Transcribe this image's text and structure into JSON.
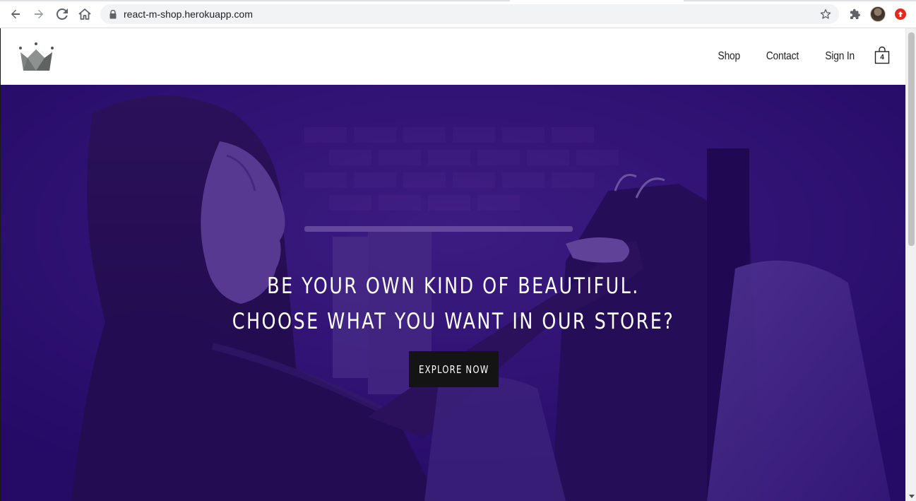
{
  "browser": {
    "url": "react-m-shop.herokuapp.com",
    "icons": {
      "back": "arrow-left-icon",
      "forward": "arrow-right-icon",
      "reload": "reload-icon",
      "home": "home-icon",
      "lock": "lock-icon",
      "bookmark": "star-icon",
      "extensions": "puzzle-icon",
      "profile": "avatar",
      "update": "update-arrow-icon"
    }
  },
  "site": {
    "logo_icon": "crown-icon",
    "nav": [
      {
        "label": "Shop"
      },
      {
        "label": "Contact"
      },
      {
        "label": "Sign In"
      }
    ],
    "cart": {
      "count": "4",
      "icon": "shopping-bag-icon"
    },
    "hero": {
      "line1": "BE YOUR OWN KIND OF BEAUTIFUL.",
      "line2": "CHOOSE WHAT YOU WANT IN OUR STORE?",
      "cta_label": "EXPLORE NOW"
    },
    "colors": {
      "hero_tint": "#2d0c78",
      "cta_bg": "#141414",
      "logo_gray": "#6b6e6c"
    }
  }
}
